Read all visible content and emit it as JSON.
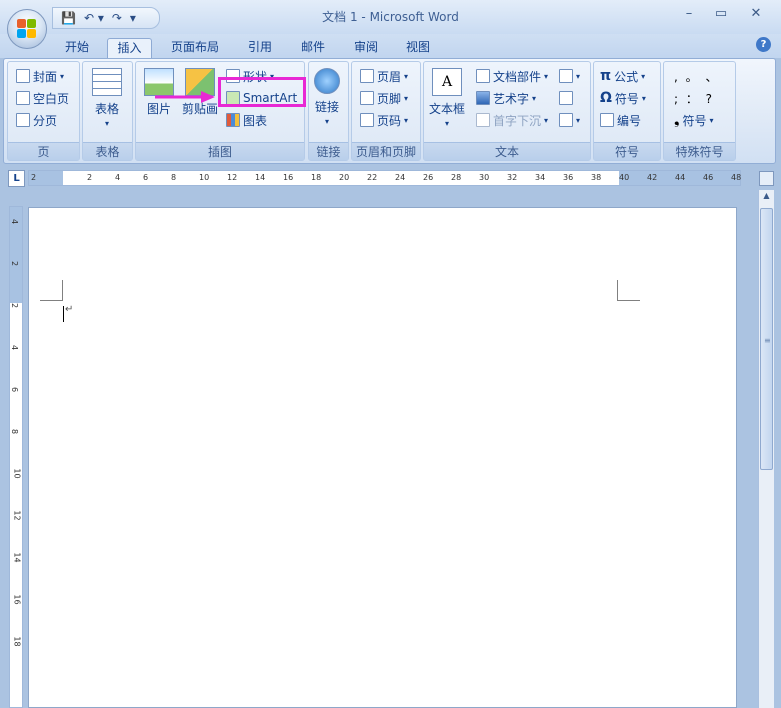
{
  "titlebar": {
    "title": "文档 1 - Microsoft Word",
    "qat_save": "💾",
    "qat_undo": "↶ ▾",
    "qat_redo": "↷",
    "qat_customize": "▾",
    "minimize": "–",
    "maximize": "▭",
    "close": "✕"
  },
  "tabs": [
    "开始",
    "插入",
    "页面布局",
    "引用",
    "邮件",
    "审阅",
    "视图"
  ],
  "active_tab": "插入",
  "help": "?",
  "ribbon": {
    "pages": {
      "label": "页",
      "cover": "封面",
      "blank": "空白页",
      "break": "分页"
    },
    "table": {
      "label": "表格",
      "button": "表格"
    },
    "illustrations": {
      "label": "插图",
      "picture": "图片",
      "clipart": "剪贴画",
      "shapes": "形状",
      "smartart": "SmartArt",
      "chart": "图表"
    },
    "links": {
      "label": "链接",
      "button": "链接"
    },
    "header_footer": {
      "label": "页眉和页脚",
      "header": "页眉",
      "footer": "页脚",
      "page_number": "页码"
    },
    "text": {
      "label": "文本",
      "textbox": "文本框",
      "quickparts": "文档部件",
      "wordart": "艺术字",
      "dropcap": "首字下沉"
    },
    "symbols": {
      "label": "符号",
      "equation": "公式",
      "symbol": "符号",
      "numbering": "编号"
    },
    "special": {
      "label": "特殊符号",
      "row1": ",  。 、",
      "row2": ";  ：  ?",
      "symbol": "符号"
    }
  },
  "ruler": {
    "corner": "L",
    "h_ticks": [
      "2",
      "2",
      "4",
      "6",
      "8",
      "10",
      "12",
      "14",
      "16",
      "18",
      "20",
      "22",
      "24",
      "26",
      "28",
      "30",
      "32",
      "34",
      "36",
      "38",
      "40",
      "42",
      "44",
      "46",
      "48"
    ],
    "v_ticks": [
      "4",
      "2",
      "2",
      "4",
      "6",
      "8",
      "10",
      "12",
      "14",
      "16",
      "18"
    ]
  },
  "document": {
    "paragraph_mark": "↵"
  },
  "colors": {
    "highlight": "#e828d4",
    "accent": "#15428b"
  }
}
